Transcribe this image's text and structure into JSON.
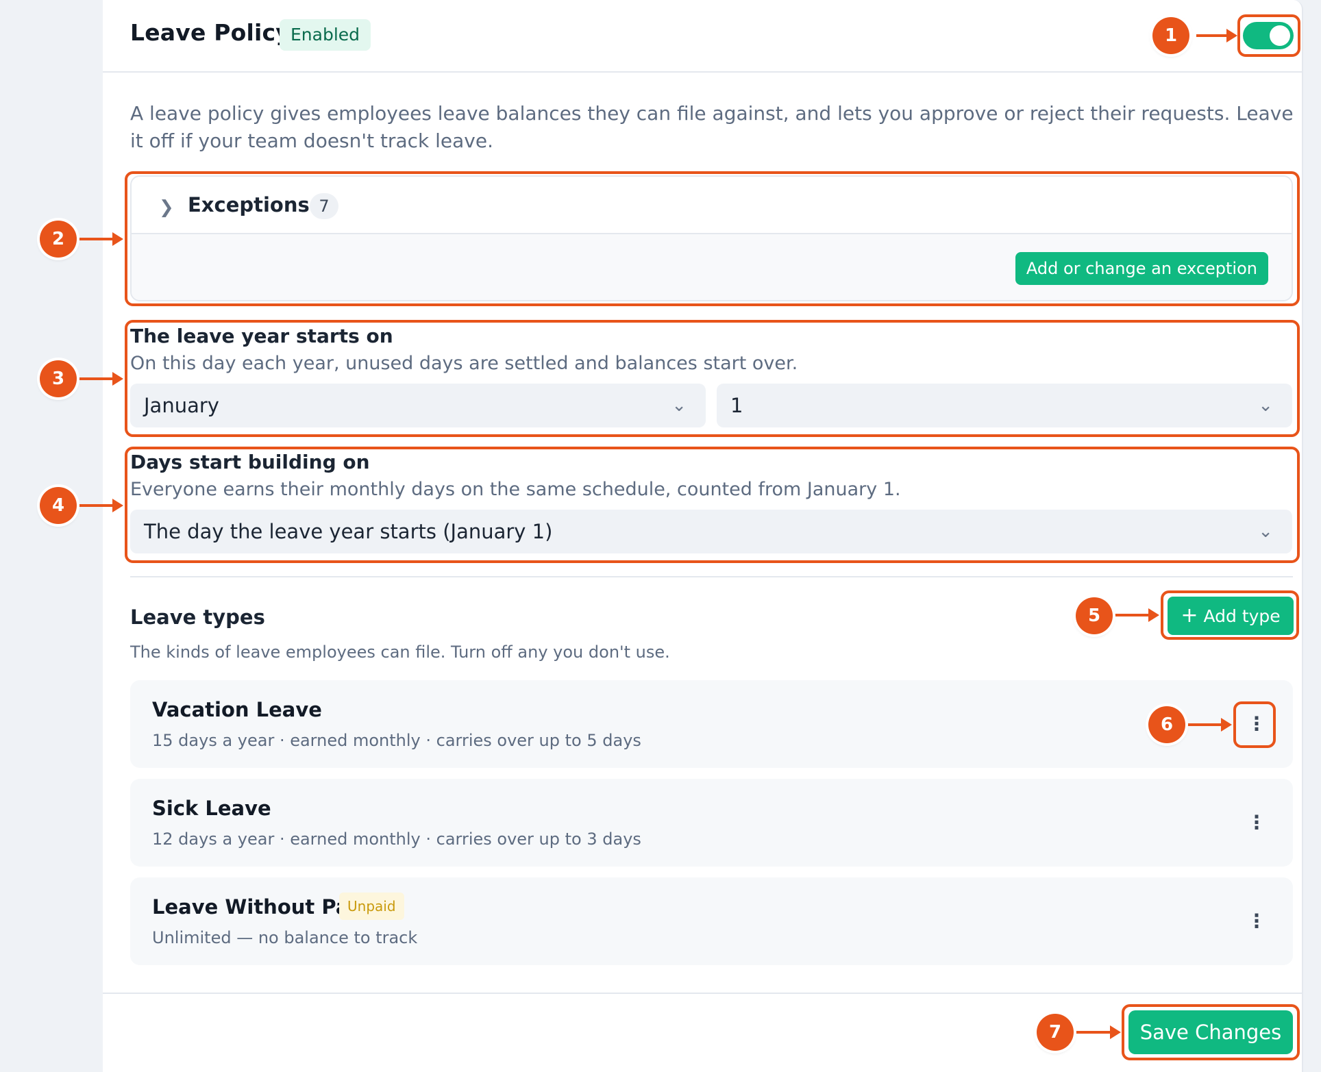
{
  "header": {
    "title": "Leave Policy",
    "status_badge": "Enabled",
    "toggle_on": true
  },
  "description": "A leave policy gives employees leave balances they can file against, and lets you approve or reject their requests. Leave it off if your team doesn't track leave.",
  "exceptions": {
    "label": "Exceptions",
    "count": "7",
    "button_label": "Add or change an exception"
  },
  "leave_year": {
    "label": "The leave year starts on",
    "help": "On this day each year, unused days are settled and balances start over.",
    "month_value": "January",
    "day_value": "1"
  },
  "building": {
    "label": "Days start building on",
    "help": "Everyone earns their monthly days on the same schedule, counted from January 1.",
    "value": "The day the leave year starts (January 1)"
  },
  "leave_types": {
    "title": "Leave types",
    "subtitle": "The kinds of leave employees can file. Turn off any you don't use.",
    "add_label": "Add type",
    "items": [
      {
        "name": "Vacation Leave",
        "details": "15 days a year · earned monthly · carries over up to 5 days"
      },
      {
        "name": "Sick Leave",
        "details": "12 days a year · earned monthly · carries over up to 3 days"
      },
      {
        "name": "Leave Without Pay",
        "badge": "Unpaid",
        "details": "Unlimited — no balance to track"
      }
    ]
  },
  "footer": {
    "save_label": "Save Changes"
  },
  "annotations": [
    "1",
    "2",
    "3",
    "4",
    "5",
    "6",
    "7"
  ],
  "colors": {
    "accent": "#10b981",
    "annotation": "#e8541a",
    "badge_enabled_bg": "#e3f7ef",
    "badge_unpaid": "#c99a0c"
  },
  "icons": {
    "toggle": "toggle-switch",
    "expand": "chevron-right-icon",
    "select": "chevron-down-icon",
    "add": "plus-icon",
    "more": "kebab-menu-icon"
  }
}
